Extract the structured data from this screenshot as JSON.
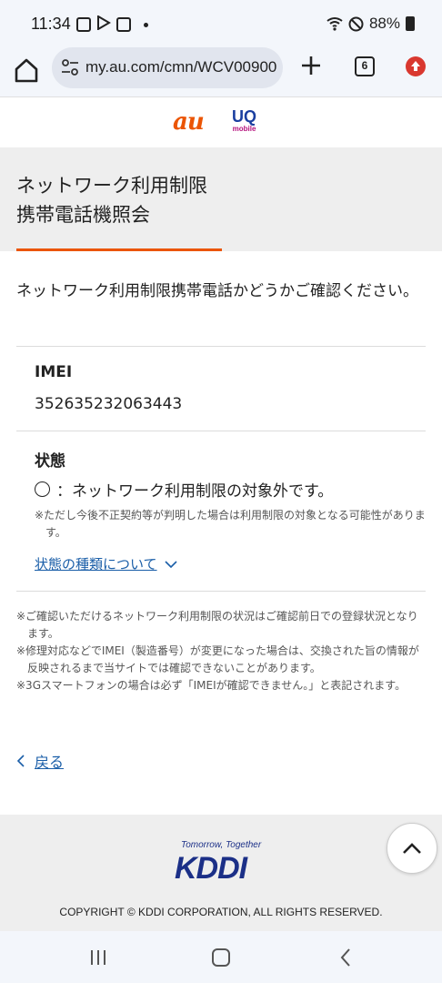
{
  "status_bar": {
    "time": "11:34",
    "battery": "88%"
  },
  "browser": {
    "url": "my.au.com/cmn/WCV00900",
    "tab_count": "6"
  },
  "logos": {
    "au": "au",
    "uq": "UQ",
    "uq_sub": "mobile"
  },
  "title": {
    "line1": "ネットワーク利用制限",
    "line2": "携帯電話機照会"
  },
  "intro": "ネットワーク利用制限携帯電話かどうかご確認ください。",
  "imei": {
    "label": "IMEI",
    "value": "352635232063443"
  },
  "status": {
    "label": "状態",
    "mark": "○",
    "text": "：ネットワーク利用制限の対象外です。",
    "note": "※ただし今後不正契約等が判明した場合は利用制限の対象となる可能性があります。",
    "about_link": "状態の種類について"
  },
  "footnotes": [
    "※ご確認いただけるネットワーク利用制限の状況はご確認前日での登録状況となります。",
    "※修理対応などでIMEI（製造番号）が変更になった場合は、交換された旨の情報が反映されるまで当サイトでは確認できないことがあります。",
    "※3Gスマートフォンの場合は必ず「IMEIが確認できません。」と表記されます。"
  ],
  "back_link": "戻る",
  "footer": {
    "tagline": "Tomorrow, Together",
    "logo": "KDDI",
    "copyright": "COPYRIGHT © KDDI CORPORATION, ALL RIGHTS RESERVED."
  },
  "colors": {
    "accent": "#eb5505",
    "link": "#1a5ea8",
    "kddi_blue": "#1b2f87"
  }
}
